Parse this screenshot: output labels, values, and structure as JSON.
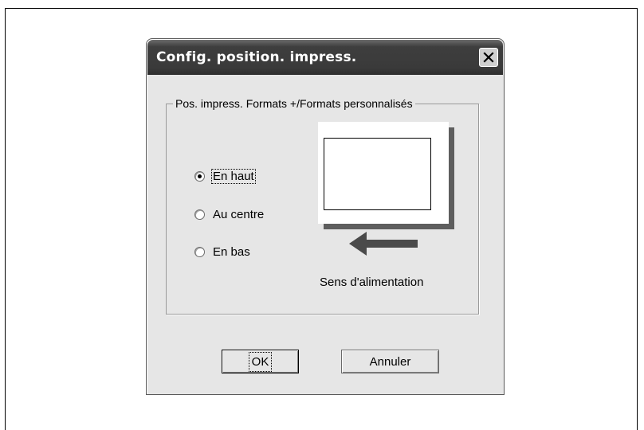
{
  "dialog": {
    "title": "Config. position. impress.",
    "close_icon": "close-x-icon"
  },
  "group": {
    "legend": "Pos. impress. Formats +/Formats personnalisés"
  },
  "radios": [
    {
      "label": "En haut",
      "checked": true
    },
    {
      "label": "Au centre",
      "checked": false
    },
    {
      "label": "En bas",
      "checked": false
    }
  ],
  "illustration": {
    "feed_label": "Sens d'alimentation",
    "arrow_icon": "left-arrow-icon"
  },
  "buttons": {
    "ok_label": "OK",
    "cancel_label": "Annuler"
  }
}
